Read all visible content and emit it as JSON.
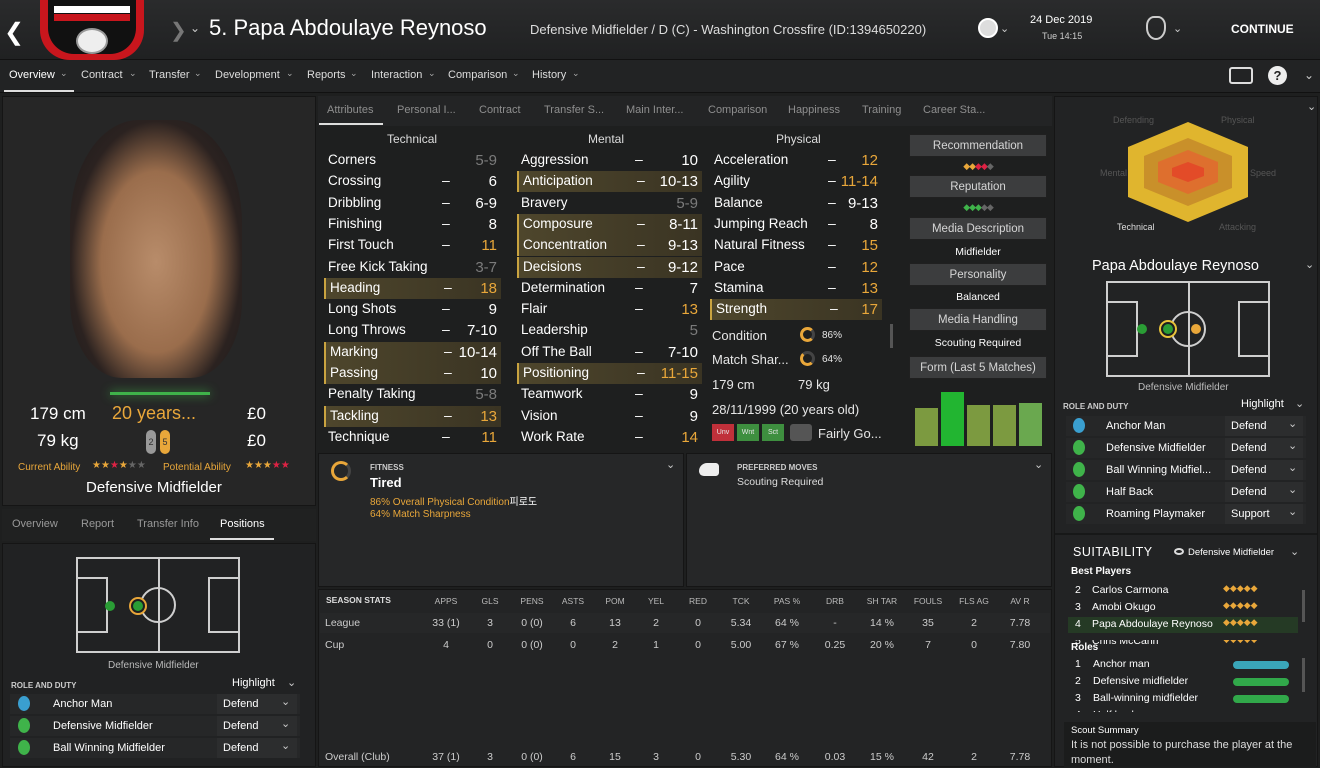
{
  "header": {
    "player_title": "5. Papa Abdoulaye Reynoso",
    "subtitle": "Defensive Midfielder / D (C) - Washington Crossfire (ID:1394650220)",
    "date": "24 Dec 2019",
    "time": "Tue 14:15",
    "continue": "CONTINUE"
  },
  "nav": [
    "Overview",
    "Contract",
    "Transfer",
    "Development",
    "Reports",
    "Interaction",
    "Comparison",
    "History"
  ],
  "tabs": [
    "Attributes",
    "Personal I...",
    "Contract",
    "Transfer S...",
    "Main Inter...",
    "Comparison",
    "Happiness",
    "Training",
    "Career Sta..."
  ],
  "groups": {
    "technical": "Technical",
    "mental": "Mental",
    "physical": "Physical"
  },
  "technical": [
    {
      "n": "Corners",
      "v": "5-9",
      "c": "dim",
      "hl": false
    },
    {
      "n": "Crossing",
      "v": "6",
      "c": "white",
      "hl": false
    },
    {
      "n": "Dribbling",
      "v": "6-9",
      "c": "white",
      "hl": false
    },
    {
      "n": "Finishing",
      "v": "8",
      "c": "white",
      "hl": false
    },
    {
      "n": "First Touch",
      "v": "11",
      "c": "orange",
      "hl": false
    },
    {
      "n": "Free Kick Taking",
      "v": "3-7",
      "c": "dim",
      "hl": false
    },
    {
      "n": "Heading",
      "v": "18",
      "c": "orange",
      "hl": true
    },
    {
      "n": "Long Shots",
      "v": "9",
      "c": "white",
      "hl": false
    },
    {
      "n": "Long Throws",
      "v": "7-10",
      "c": "white",
      "hl": false
    },
    {
      "n": "Marking",
      "v": "10-14",
      "c": "white",
      "hl": true
    },
    {
      "n": "Passing",
      "v": "10",
      "c": "white",
      "hl": true
    },
    {
      "n": "Penalty Taking",
      "v": "5-8",
      "c": "dim",
      "hl": false
    },
    {
      "n": "Tackling",
      "v": "13",
      "c": "orange",
      "hl": true
    },
    {
      "n": "Technique",
      "v": "11",
      "c": "orange",
      "hl": false
    }
  ],
  "mental": [
    {
      "n": "Aggression",
      "v": "10",
      "c": "white",
      "hl": false
    },
    {
      "n": "Anticipation",
      "v": "10-13",
      "c": "white",
      "hl": true
    },
    {
      "n": "Bravery",
      "v": "5-9",
      "c": "dim",
      "hl": false
    },
    {
      "n": "Composure",
      "v": "8-11",
      "c": "white",
      "hl": true
    },
    {
      "n": "Concentration",
      "v": "9-13",
      "c": "white",
      "hl": true
    },
    {
      "n": "Decisions",
      "v": "9-12",
      "c": "white",
      "hl": true
    },
    {
      "n": "Determination",
      "v": "7",
      "c": "white",
      "hl": false
    },
    {
      "n": "Flair",
      "v": "13",
      "c": "orange",
      "hl": false
    },
    {
      "n": "Leadership",
      "v": "5",
      "c": "dim",
      "hl": false
    },
    {
      "n": "Off The Ball",
      "v": "7-10",
      "c": "white",
      "hl": false
    },
    {
      "n": "Positioning",
      "v": "11-15",
      "c": "orange",
      "hl": true
    },
    {
      "n": "Teamwork",
      "v": "9",
      "c": "white",
      "hl": false
    },
    {
      "n": "Vision",
      "v": "9",
      "c": "white",
      "hl": false
    },
    {
      "n": "Work Rate",
      "v": "14",
      "c": "orange",
      "hl": false
    }
  ],
  "physical": [
    {
      "n": "Acceleration",
      "v": "12",
      "c": "orange",
      "hl": false
    },
    {
      "n": "Agility",
      "v": "11-14",
      "c": "orange",
      "hl": false
    },
    {
      "n": "Balance",
      "v": "9-13",
      "c": "white",
      "hl": false
    },
    {
      "n": "Jumping Reach",
      "v": "8",
      "c": "white",
      "hl": false
    },
    {
      "n": "Natural Fitness",
      "v": "15",
      "c": "orange",
      "hl": false
    },
    {
      "n": "Pace",
      "v": "12",
      "c": "orange",
      "hl": false
    },
    {
      "n": "Stamina",
      "v": "13",
      "c": "orange",
      "hl": false
    },
    {
      "n": "Strength",
      "v": "17",
      "c": "orange",
      "hl": true
    }
  ],
  "condition": {
    "label": "Condition",
    "value": "86%",
    "sharp_label": "Match Shar...",
    "sharp": "64%",
    "height": "179 cm",
    "weight": "79 kg",
    "dob": "28/11/1999 (20 years old)",
    "feet_label": "Fairly Go...",
    "tags": [
      "Unv",
      "Wnt",
      "Sct"
    ]
  },
  "side": {
    "rec": "Recommendation",
    "rep": "Reputation",
    "media": "Media Description",
    "media_val": "Midfielder",
    "pers": "Personality",
    "pers_val": "Balanced",
    "handling": "Media Handling",
    "handling_val": "Scouting Required",
    "form": "Form (Last 5 Matches)",
    "form_values": [
      0.7,
      1.0,
      0.75,
      0.75,
      0.8
    ]
  },
  "profile": {
    "height": "179 cm",
    "age": "20 years...",
    "value": "£0",
    "weight": "79 kg",
    "wage": "£0",
    "ca": "Current Ability",
    "pa": "Potential Ability",
    "position": "Defensive Midfielder",
    "foot_left": "2",
    "foot_right": "5"
  },
  "lefttabs": [
    "Overview",
    "Report",
    "Transfer Info",
    "Positions"
  ],
  "pitch_label": "Defensive Midfielder",
  "roles_hdr": "ROLE AND DUTY",
  "highlight": "Highlight",
  "left_roles": [
    {
      "r": "Anchor Man",
      "d": "Defend"
    },
    {
      "r": "Defensive Midfielder",
      "d": "Defend"
    },
    {
      "r": "Ball Winning Midfielder",
      "d": "Defend"
    }
  ],
  "fitness": {
    "hdr": "FITNESS",
    "state": "Tired",
    "line1": "86% Overall Physical Condition",
    "line1b": "피로도",
    "line2": "64% Match Sharpness"
  },
  "moves": {
    "hdr": "PREFERRED MOVES",
    "val": "Scouting Required"
  },
  "stats": {
    "hdr": "SEASON STATS",
    "cols": [
      "APPS",
      "GLS",
      "PENS",
      "ASTS",
      "POM",
      "YEL",
      "RED",
      "TCK",
      "PAS %",
      "DRB",
      "SH TAR",
      "FOULS",
      "FLS AG",
      "AV R"
    ],
    "rows": [
      {
        "name": "League",
        "v": [
          "33 (1)",
          "3",
          "0 (0)",
          "6",
          "13",
          "2",
          "0",
          "5.34",
          "64 %",
          "-",
          "14 %",
          "35",
          "2",
          "7.78"
        ]
      },
      {
        "name": "Cup",
        "v": [
          "4",
          "0",
          "0 (0)",
          "0",
          "2",
          "1",
          "0",
          "5.00",
          "67 %",
          "0.25",
          "20 %",
          "7",
          "0",
          "7.80"
        ]
      },
      {
        "name": "Overall (Club)",
        "v": [
          "37 (1)",
          "3",
          "0 (0)",
          "6",
          "15",
          "3",
          "0",
          "5.30",
          "64 %",
          "0.03",
          "15 %",
          "42",
          "2",
          "7.78"
        ]
      }
    ]
  },
  "right": {
    "radar_labels": [
      "Defending",
      "Physical",
      "Speed",
      "Attacking",
      "Technical",
      "Mental"
    ],
    "name": "Papa Abdoulaye Reynoso",
    "pos": "Defensive Midfielder",
    "roles": [
      {
        "r": "Anchor Man",
        "d": "Defend"
      },
      {
        "r": "Defensive Midfielder",
        "d": "Defend"
      },
      {
        "r": "Ball Winning Midfiel...",
        "d": "Defend"
      },
      {
        "r": "Half Back",
        "d": "Defend"
      },
      {
        "r": "Roaming Playmaker",
        "d": "Support"
      }
    ],
    "suit": "SUITABILITY",
    "suit_role": "Defensive Midfielder",
    "best": "Best Players",
    "best_list": [
      {
        "i": "2",
        "n": "Carlos Carmona"
      },
      {
        "i": "3",
        "n": "Amobi Okugo"
      },
      {
        "i": "4",
        "n": "Papa Abdoulaye Reynoso"
      },
      {
        "i": "5",
        "n": "Chris McCann"
      }
    ],
    "roles_t": "Roles",
    "role_list": [
      {
        "i": "1",
        "n": "Anchor man"
      },
      {
        "i": "2",
        "n": "Defensive midfielder"
      },
      {
        "i": "3",
        "n": "Ball-winning midfielder"
      },
      {
        "i": "4",
        "n": "Half back"
      }
    ],
    "scout_t": "Scout Summary",
    "scout": "It is not possible to purchase the player at the moment."
  }
}
